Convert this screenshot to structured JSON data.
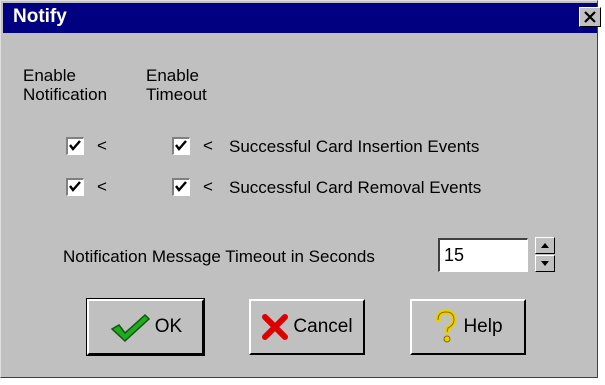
{
  "window": {
    "title": "Notify",
    "close_glyph": "×"
  },
  "columns": {
    "enable_notification": [
      "Enable",
      "Notification"
    ],
    "enable_timeout": [
      "Enable",
      "Timeout"
    ]
  },
  "rows": [
    {
      "label": "Successful Card Insertion Events",
      "notification_checked": true,
      "timeout_checked": true,
      "marker": "<"
    },
    {
      "label": "Successful Card Removal Events",
      "notification_checked": true,
      "timeout_checked": true,
      "marker": "<"
    }
  ],
  "timeout": {
    "label": "Notification Message Timeout in Seconds",
    "value": "15"
  },
  "buttons": {
    "ok": {
      "label": "OK",
      "icon": "checkmark-icon"
    },
    "cancel": {
      "label": "Cancel",
      "icon": "x-icon"
    },
    "help": {
      "label": "Help",
      "icon": "question-icon"
    }
  },
  "colors": {
    "titlebar": "#000080",
    "face": "#c0c0c0",
    "ok_icon": "#22aa22",
    "cancel_icon": "#dd0000",
    "help_icon": "#e8d000"
  }
}
